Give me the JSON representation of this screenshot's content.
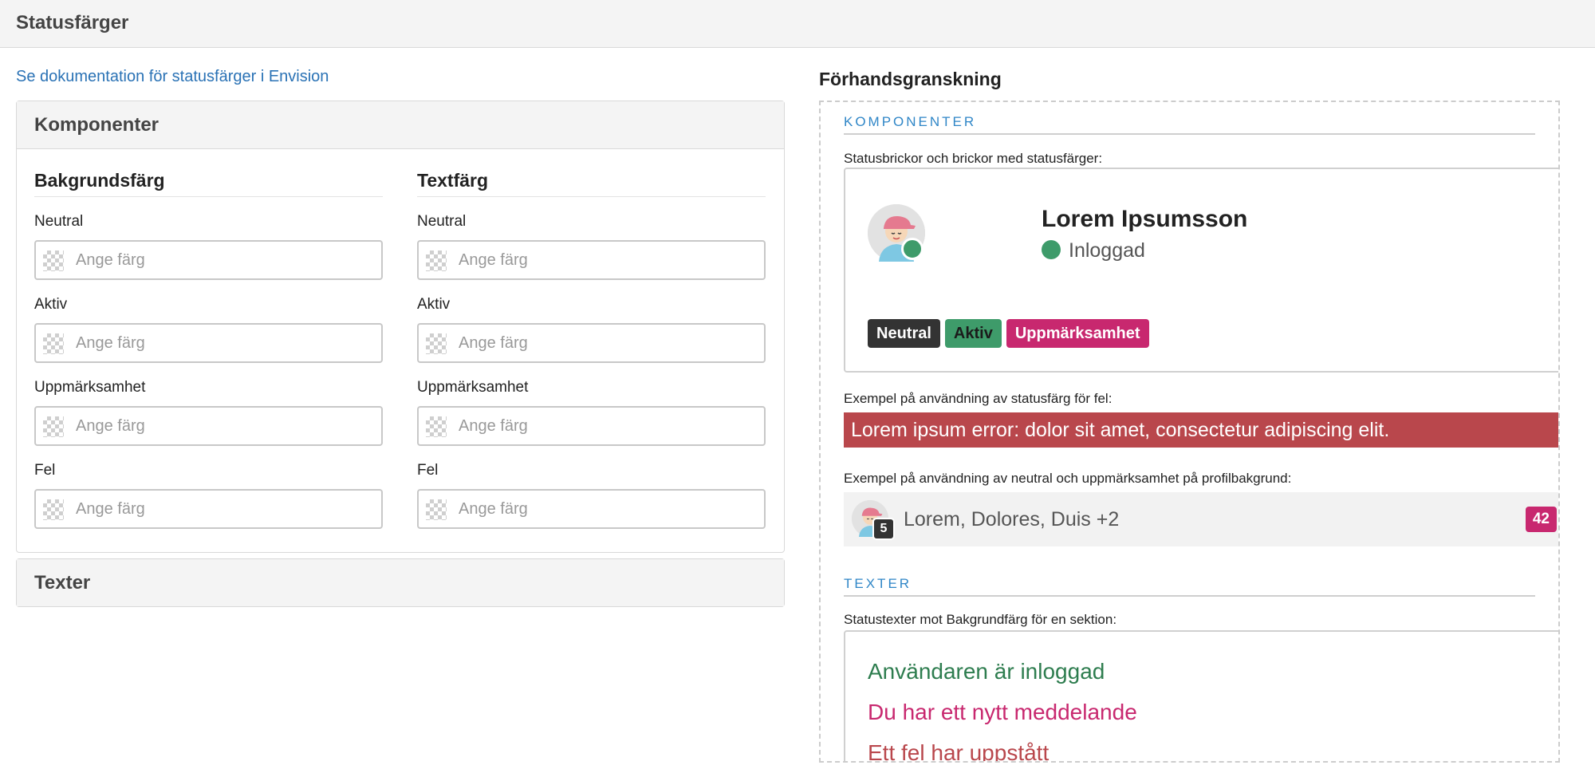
{
  "header": {
    "title": "Statusfärger"
  },
  "doc_link": "Se dokumentation för statusfärger i Envision",
  "components_panel": {
    "title": "Komponenter",
    "background_column": {
      "heading": "Bakgrundsfärg",
      "fields": [
        {
          "label": "Neutral",
          "value": "",
          "placeholder": "Ange färg"
        },
        {
          "label": "Aktiv",
          "value": "",
          "placeholder": "Ange färg"
        },
        {
          "label": "Uppmärksamhet",
          "value": "",
          "placeholder": "Ange färg"
        },
        {
          "label": "Fel",
          "value": "",
          "placeholder": "Ange färg"
        }
      ]
    },
    "text_column": {
      "heading": "Textfärg",
      "fields": [
        {
          "label": "Neutral",
          "value": "",
          "placeholder": "Ange färg"
        },
        {
          "label": "Aktiv",
          "value": "",
          "placeholder": "Ange färg"
        },
        {
          "label": "Uppmärksamhet",
          "value": "",
          "placeholder": "Ange färg"
        },
        {
          "label": "Fel",
          "value": "",
          "placeholder": "Ange färg"
        }
      ]
    }
  },
  "texts_panel": {
    "title": "Texter"
  },
  "preview": {
    "title": "Förhandsgranskning",
    "components_heading": "KOMPONENTER",
    "badges_desc": "Statusbrickor och brickor med statusfärger:",
    "user": {
      "name": "Lorem Ipsumsson",
      "status": "Inloggad"
    },
    "badges": {
      "neutral": "Neutral",
      "aktiv": "Aktiv",
      "upp": "Uppmärksamhet"
    },
    "error_desc": "Exempel på användning av statusfärg för fel:",
    "error_text": "Lorem ipsum error: dolor sit amet, consectetur adipiscing elit.",
    "profile_desc": "Exempel på användning av neutral och uppmärksamhet på profilbakgrund:",
    "profile": {
      "count": "5",
      "names": "Lorem, Dolores, Duis +2",
      "badge": "42"
    },
    "texts_heading": "TEXTER",
    "texts_desc": "Statustexter mot Bakgrundfärg för en sektion:",
    "status_texts": {
      "ok": "Användaren är inloggad",
      "message": "Du har ett nytt meddelande",
      "error": "Ett fel har uppstått"
    }
  },
  "colors": {
    "neutral": "#333333",
    "active": "#3e9b6a",
    "attention": "#c8286f",
    "error": "#b9474c",
    "link": "#2a72b5",
    "section_heading": "#2f86c7"
  }
}
